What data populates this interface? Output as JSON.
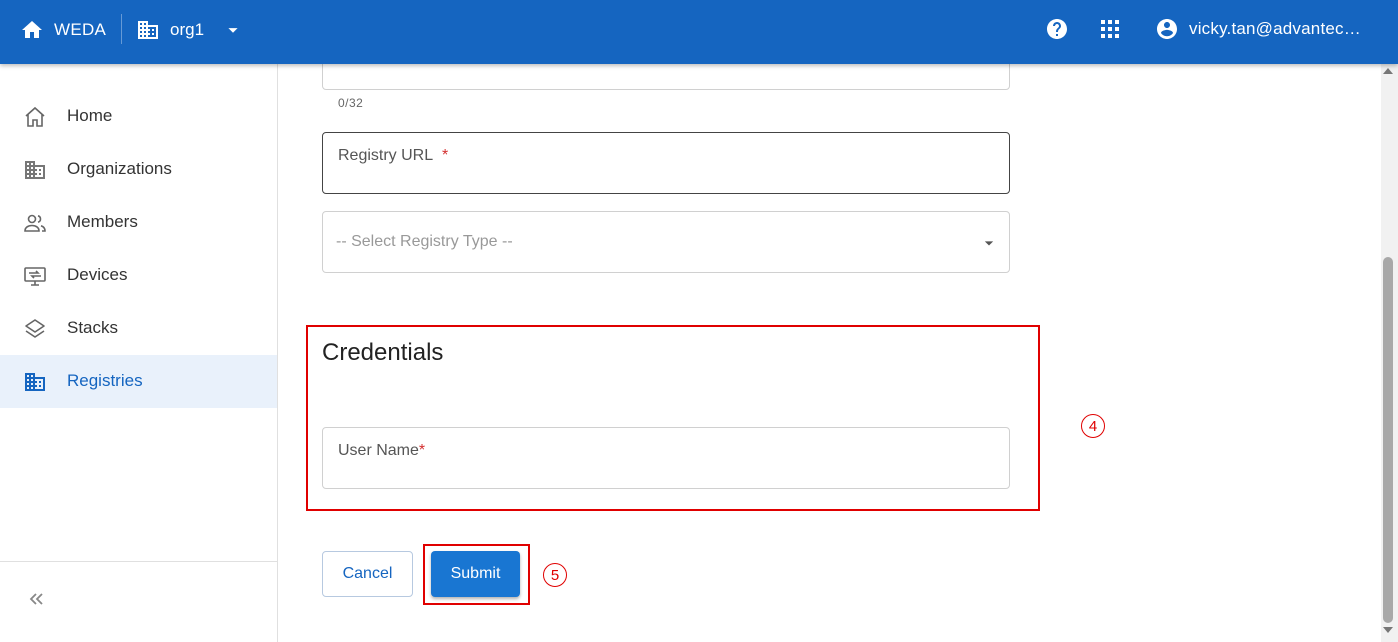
{
  "topbar": {
    "home_label": "WEDA",
    "org_label": "org1",
    "user_label": "vicky.tan@advantech.com",
    "bg_color": "#1565c0"
  },
  "sidebar": {
    "items": [
      {
        "label": "Home",
        "icon": "home-outline-icon"
      },
      {
        "label": "Organizations",
        "icon": "building-icon"
      },
      {
        "label": "Members",
        "icon": "people-icon"
      },
      {
        "label": "Devices",
        "icon": "monitor-icon"
      },
      {
        "label": "Stacks",
        "icon": "layers-icon"
      },
      {
        "label": "Registries",
        "icon": "building-icon",
        "active": true
      }
    ]
  },
  "form": {
    "char_counter": "0/32",
    "registry_url_label": "Registry URL",
    "required_marker": "*",
    "registry_type_placeholder": "-- Select Registry Type --",
    "credentials_title": "Credentials",
    "username_label": "User Name",
    "cancel_label": "Cancel",
    "submit_label": "Submit"
  },
  "annotations": {
    "step4": "4",
    "step5": "5",
    "highlight_color": "#e00000"
  }
}
